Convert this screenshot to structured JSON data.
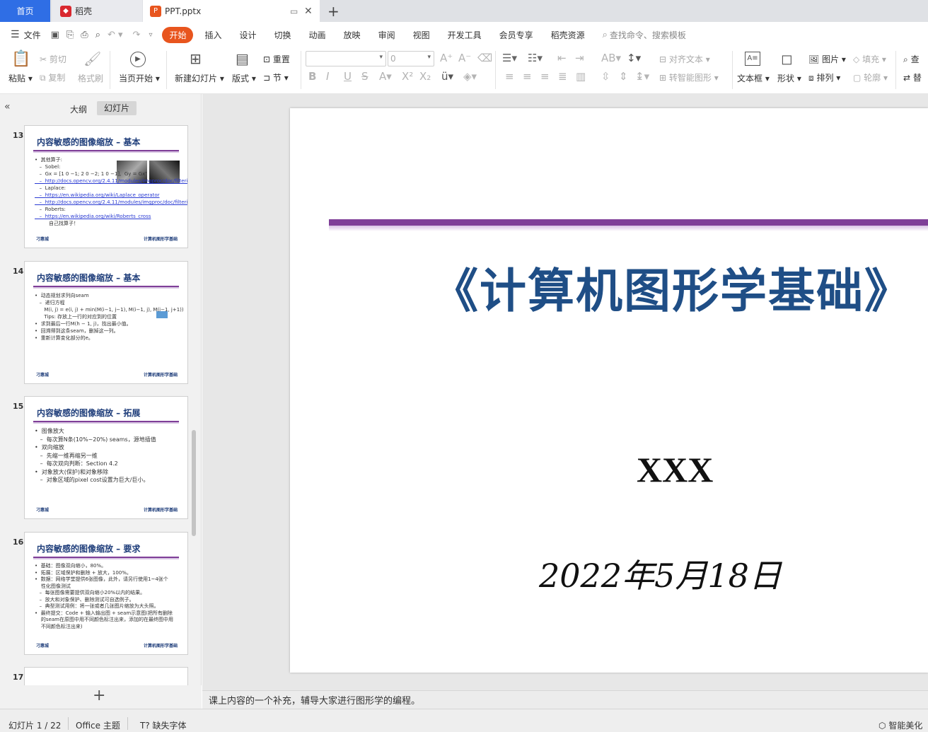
{
  "tabs": {
    "home": "首页",
    "daoke": "稻壳",
    "file": "PPT.pptx"
  },
  "menu": {
    "file": "文件",
    "items": [
      "开始",
      "插入",
      "设计",
      "切换",
      "动画",
      "放映",
      "审阅",
      "视图",
      "开发工具",
      "会员专享",
      "稻壳资源"
    ],
    "search": "查找命令、搜索模板"
  },
  "ribbon": {
    "paste": "粘贴",
    "cut": "剪切",
    "copy": "复制",
    "format_painter": "格式刷",
    "play_from_current": "当页开始",
    "new_slide": "新建幻灯片",
    "layout": "版式",
    "reset": "重置",
    "section": "节",
    "font_size": "0",
    "align_text": "对齐文本",
    "to_smartart": "转智能图形",
    "textbox": "文本框",
    "shape": "形状",
    "arrange": "排列",
    "picture": "图片",
    "fill": "填充",
    "outline": "轮廓",
    "find": "查",
    "replace": "替"
  },
  "panel": {
    "outline": "大纲",
    "slides": "幻灯片"
  },
  "thumbs": [
    {
      "num": "13",
      "title": "内容敏感的图像缩放 – 基本",
      "lines": [
        "•  其他算子:",
        "   –  Sobel:",
        "   –  Gx = [1 0 −1; 2 0 −2; 1 0 −1],  Gy = Gxᵀ",
        "   –  http://docs.opencv.org/2.4.11/modules/imgproc/doc/filtering.html#sobel",
        "",
        "   –  Laplace:",
        "   –  https://en.wikipedia.org/wiki/Laplace_operator",
        "   –  http://docs.opencv.org/2.4.11/modules/imgproc/doc/filtering.html#laplacian",
        "",
        "   –  Roberts:",
        "   –  https://en.wikipedia.org/wiki/Roberts_cross",
        "         自己找算子！"
      ],
      "foot_l": "刁惠城",
      "foot_r": "计算机图形学基础"
    },
    {
      "num": "14",
      "title": "内容敏感的图像缩放 – 基本",
      "lines": [
        "•  动态规划求列向seam",
        "   –  递归方程",
        "      M(i, j) = e(i, j) + min(M(i−1, j−1), M(i−1, j), M(i−1, j+1))",
        "      Tips: 存放上一行的对应到的位置",
        "",
        "",
        "•  求到最后一行M(h − 1, j)，找出最小值。",
        "•  回溯得到这条seam，删掉这一列。",
        "•  重新计算变化部分的e。"
      ],
      "foot_l": "刁惠城",
      "foot_r": "计算机图形学基础"
    },
    {
      "num": "15",
      "title": "内容敏感的图像缩放 – 拓展",
      "lines": [
        "•  图像放大",
        "   –  每次算N条(10%~20%) seams，源地插值",
        "",
        "•  双向缩放",
        "   –  先缩一维再缩另一维",
        "   –  每次双向判断：Section 4.2",
        "",
        "•  对象放大(保护)和对象移除",
        "   –  对象区域的pixel cost设置为巨大/巨小。"
      ],
      "foot_l": "刁惠城",
      "foot_r": "计算机图形学基础"
    },
    {
      "num": "16",
      "title": "内容敏感的图像缩放 – 要求",
      "lines": [
        "•  基础：图像双向缩小，80%。",
        "•  拓展：区域保护和删除 + 放大，100%。",
        "",
        "•  数据：网络学堂提供6张图像，此外，请另行使用1~4张个",
        "    性化图像测试",
        "   –  每张图像需要提供双向缩小20%以内的结果。",
        "   –  放大和对象保护、删除测试可自选例子。",
        "   –  典型测试用例：将一张或者几张图片缩放为大头照。",
        "",
        "•  最终提交：Code + 输入输出图 + seam示意图(把所有删除",
        "    的seam在原图中用不同颜色标注出来，添加的在最终图中用",
        "    不同颜色标注出来)"
      ],
      "foot_l": "刁惠城",
      "foot_r": "计算机图形学基础"
    }
  ],
  "next_slide_num": "17",
  "slide": {
    "title": "《计算机图形学基础》",
    "author": "XXX",
    "date": "2022年5月18日"
  },
  "notes": "课上内容的一个补充，辅导大家进行图形学的编程。",
  "status": {
    "slide_count": "幻灯片 1 / 22",
    "theme": "Office 主题",
    "missing_font": "缺失字体",
    "beautify": "智能美化"
  },
  "colors": {
    "accent": "#e8551e",
    "home_tab": "#2f6ee5",
    "title_blue": "#1f4e86",
    "band_purple": "#7f3f98"
  }
}
